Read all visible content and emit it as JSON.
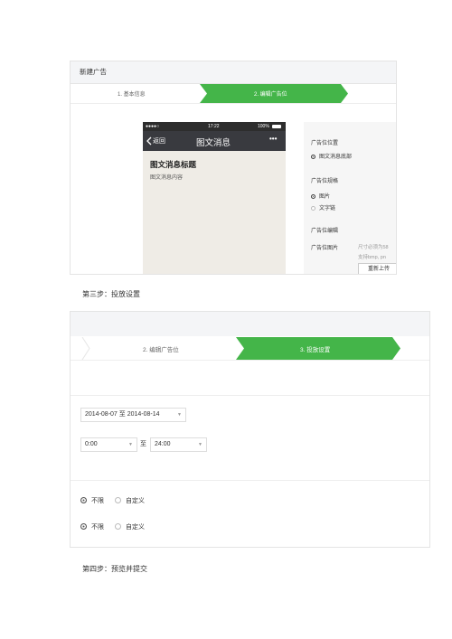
{
  "shot1": {
    "header_title": "新建广告",
    "steps": [
      "1. 基本信息",
      "2. 编辑广告位"
    ],
    "phone": {
      "carrier": "●●●●○",
      "time": "17:22",
      "battery": "100%",
      "back_label": "返回",
      "nav_title": "图文消息",
      "more_icon": "•••",
      "article_title": "图文消息标题",
      "article_body": "图文消息内容"
    },
    "panel": {
      "position_label": "广告位位置",
      "position_option": "图文消息底部",
      "spec_label": "广告位规格",
      "spec_options": [
        "图片",
        "文字链"
      ],
      "edit_label": "广告位编辑",
      "image_label": "广告位图片",
      "image_hint_1": "尺寸必须为58",
      "image_hint_2": "支持bmp, pn",
      "reupload_button": "重新上传"
    }
  },
  "caption_step3": "第三步：投放设置",
  "shot2": {
    "steps": [
      "2. 编辑广告位",
      "3. 投放设置"
    ],
    "date_range": "2014-08-07 至 2014-08-14",
    "time_start": "0:00",
    "time_to": "至",
    "time_end": "24:00",
    "radio_rows": [
      {
        "selected": "不限",
        "other": "自定义"
      },
      {
        "selected": "不限",
        "other": "自定义"
      }
    ]
  },
  "caption_step4": "第四步：预览并提交"
}
